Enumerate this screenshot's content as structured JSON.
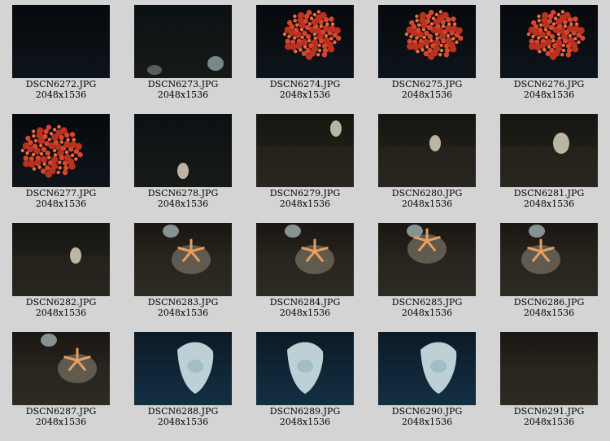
{
  "gallery": {
    "items": [
      {
        "filename": "DSCN6272.JPG",
        "dimensions": "2048x1536",
        "scene": "dark-water",
        "subject": "none"
      },
      {
        "filename": "DSCN6273.JPG",
        "dimensions": "2048x1536",
        "scene": "dark-seafloor",
        "subject": "sponges"
      },
      {
        "filename": "DSCN6274.JPG",
        "dimensions": "2048x1536",
        "scene": "dark-water",
        "subject": "red-coral"
      },
      {
        "filename": "DSCN6275.JPG",
        "dimensions": "2048x1536",
        "scene": "dark-water",
        "subject": "red-coral"
      },
      {
        "filename": "DSCN6276.JPG",
        "dimensions": "2048x1536",
        "scene": "dark-water",
        "subject": "red-coral"
      },
      {
        "filename": "DSCN6277.JPG",
        "dimensions": "2048x1536",
        "scene": "dark-water",
        "subject": "red-coral"
      },
      {
        "filename": "DSCN6278.JPG",
        "dimensions": "2048x1536",
        "scene": "dark-seafloor",
        "subject": "small-shell"
      },
      {
        "filename": "DSCN6279.JPG",
        "dimensions": "2048x1536",
        "scene": "seafloor",
        "subject": "small-shell"
      },
      {
        "filename": "DSCN6280.JPG",
        "dimensions": "2048x1536",
        "scene": "seafloor",
        "subject": "small-shell"
      },
      {
        "filename": "DSCN6281.JPG",
        "dimensions": "2048x1536",
        "scene": "seafloor",
        "subject": "small-shell"
      },
      {
        "filename": "DSCN6282.JPG",
        "dimensions": "2048x1536",
        "scene": "seafloor",
        "subject": "small-shell"
      },
      {
        "filename": "DSCN6283.JPG",
        "dimensions": "2048x1536",
        "scene": "rocky-seafloor",
        "subject": "starfish"
      },
      {
        "filename": "DSCN6284.JPG",
        "dimensions": "2048x1536",
        "scene": "rocky-seafloor",
        "subject": "starfish"
      },
      {
        "filename": "DSCN6285.JPG",
        "dimensions": "2048x1536",
        "scene": "rocky-seafloor",
        "subject": "starfish"
      },
      {
        "filename": "DSCN6286.JPG",
        "dimensions": "2048x1536",
        "scene": "rocky-seafloor",
        "subject": "starfish"
      },
      {
        "filename": "DSCN6287.JPG",
        "dimensions": "2048x1536",
        "scene": "rocky-seafloor",
        "subject": "starfish"
      },
      {
        "filename": "DSCN6288.JPG",
        "dimensions": "2048x1536",
        "scene": "blue-water",
        "subject": "white-sponge"
      },
      {
        "filename": "DSCN6289.JPG",
        "dimensions": "2048x1536",
        "scene": "blue-water",
        "subject": "white-sponge"
      },
      {
        "filename": "DSCN6290.JPG",
        "dimensions": "2048x1536",
        "scene": "blue-water",
        "subject": "white-sponge"
      },
      {
        "filename": "DSCN6291.JPG",
        "dimensions": "2048x1536",
        "scene": "rocky-seafloor",
        "subject": "none"
      }
    ]
  },
  "colors": {
    "page_background": "#d4d4d4",
    "dark_water": "#0b1116",
    "seafloor": "#1a1a16",
    "coral_red": "#d8452c",
    "starfish_orange": "#e8a060",
    "sponge_white": "#cfe3e8",
    "shell_pale": "#d9d0bd"
  }
}
